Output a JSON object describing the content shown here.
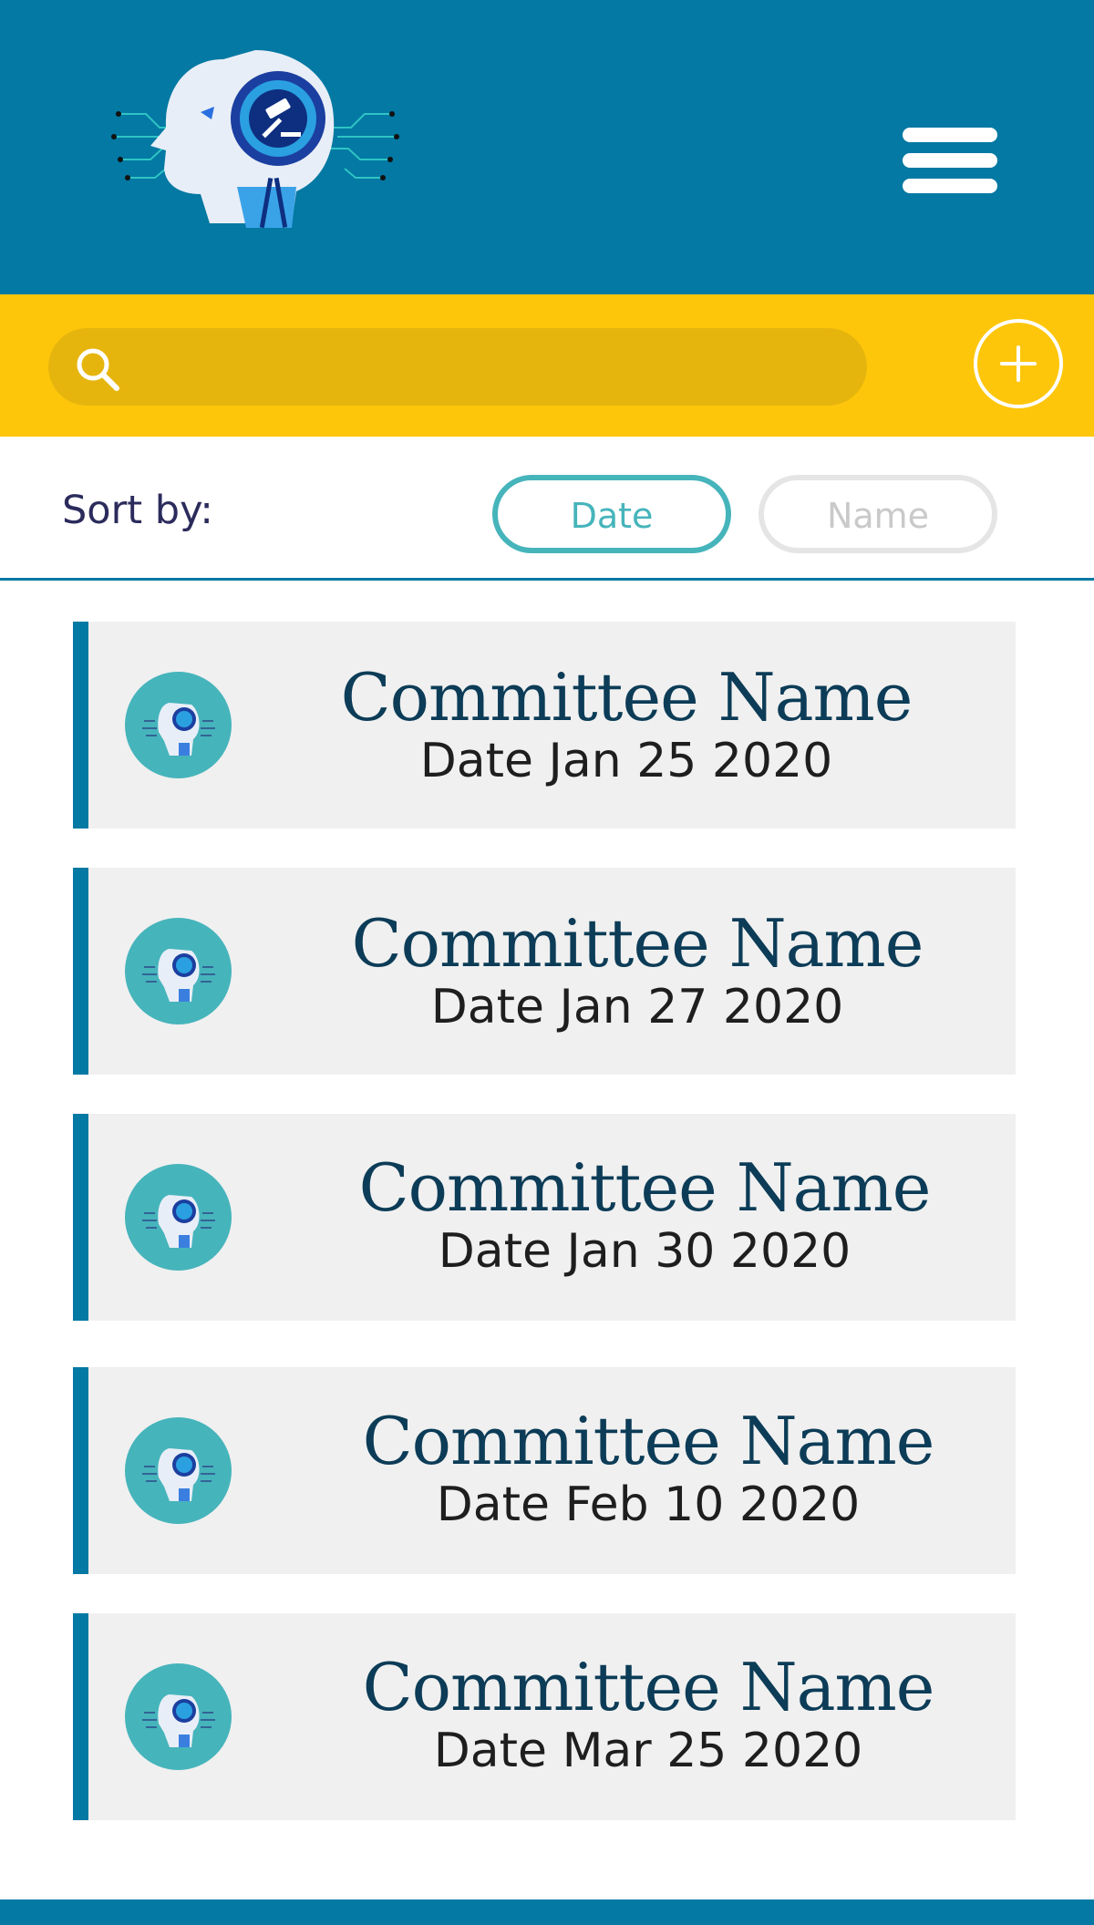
{
  "header": {
    "logo_icon": "ai-judge-head-logo",
    "menu_icon": "hamburger-menu-icon"
  },
  "search": {
    "placeholder": "",
    "value": "",
    "add_icon": "plus-circle-icon"
  },
  "sort": {
    "label": "Sort by:",
    "options": [
      "Date",
      "Name"
    ],
    "selected": "Date"
  },
  "committees": [
    {
      "name": "Committee Name",
      "date": "Date Jan 25 2020"
    },
    {
      "name": "Committee Name",
      "date": "Date Jan 27 2020"
    },
    {
      "name": "Committee Name",
      "date": "Date Jan 30 2020"
    },
    {
      "name": "Committee Name",
      "date": "Date Feb 10 2020"
    },
    {
      "name": "Committee Name",
      "date": "Date Mar 25 2020"
    }
  ],
  "colors": {
    "header_bg": "#0379a3",
    "search_bg": "#fec60b",
    "accent_teal": "#46b4bb",
    "title_text": "#0c3c57"
  }
}
